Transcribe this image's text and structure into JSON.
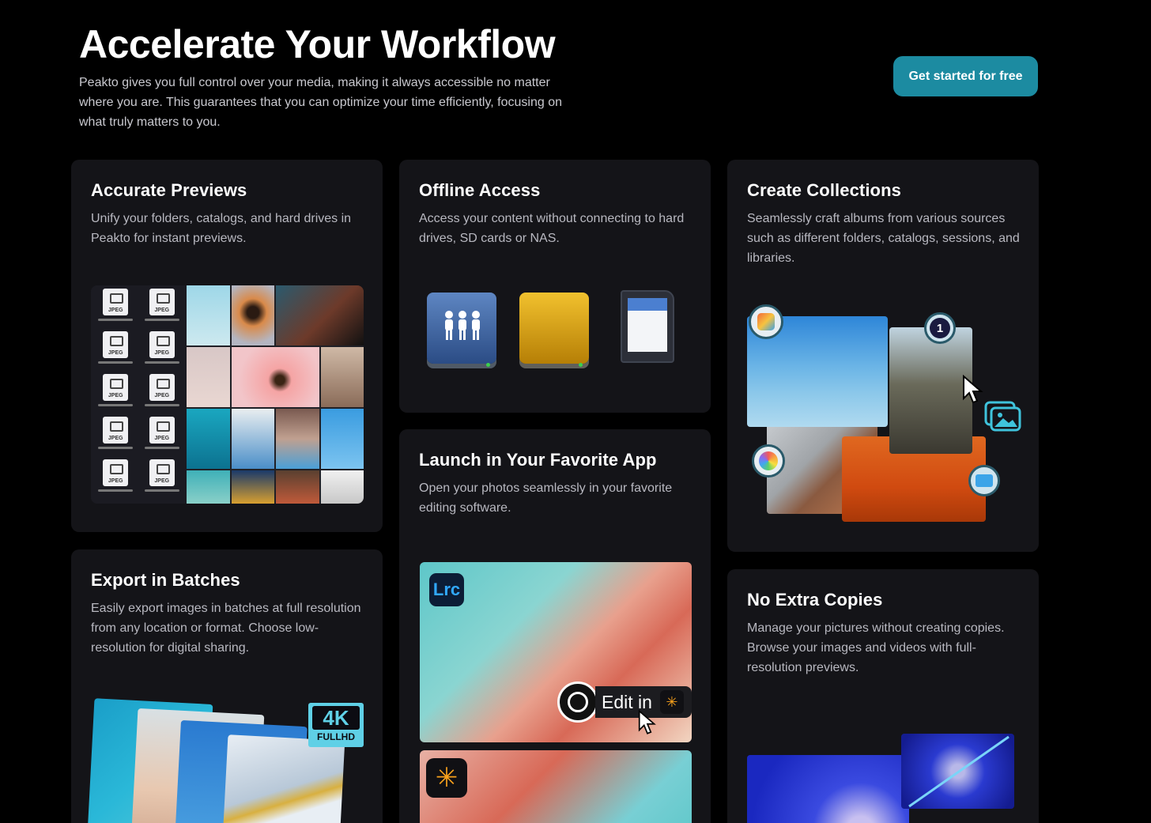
{
  "hero": {
    "title": "Accelerate Your Workflow",
    "description": "Peakto gives you full control over your media, making it always accessible no matter where you are. This guarantees that you can optimize your time efficiently, focusing on what truly matters to you.",
    "cta_label": "Get started for free"
  },
  "cards": {
    "previews": {
      "title": "Accurate Previews",
      "text": "Unify your folders, catalogs, and hard drives in Peakto for instant previews."
    },
    "offline": {
      "title": "Offline Access",
      "text": "Access your content without connecting to hard drives, SD cards or NAS."
    },
    "collections": {
      "title": "Create Collections",
      "text": "Seamlessly craft albums from various sources such as different folders, catalogs, sessions, and libraries."
    },
    "launch": {
      "title": "Launch in Your Favorite App",
      "text": "Open your photos seamlessly in your favorite editing software.",
      "lrc_label": "Lrc",
      "edit_label": "Edit in"
    },
    "export": {
      "title": "Export in Batches",
      "text": "Easily export images in batches at full resolution from any location or format. Choose low-resolution for digital sharing.",
      "badge_4k": "4K",
      "badge_fullhd": "FULLHD"
    },
    "nocopies": {
      "title": "No Extra Copies",
      "text": "Manage your pictures without creating copies. Browse your images and videos with full-resolution previews."
    }
  },
  "colors": {
    "accent": "#1c8ba1",
    "card_bg": "#141418",
    "page_bg": "#000000"
  }
}
